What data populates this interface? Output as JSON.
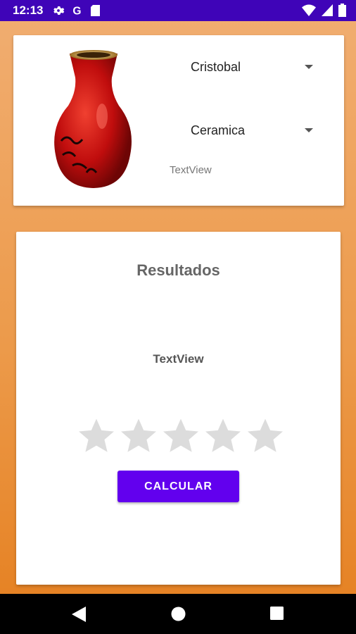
{
  "status_bar": {
    "time": "12:13",
    "left_icons": [
      "gear-icon",
      "google-icon",
      "sd-card-icon"
    ],
    "right_icons": [
      "wifi-icon",
      "signal-icon",
      "battery-icon"
    ]
  },
  "top_card": {
    "image": "red-vase",
    "spinner_author": "Cristobal",
    "spinner_material": "Ceramica",
    "textview": "TextView"
  },
  "results_card": {
    "title": "Resultados",
    "textview": "TextView",
    "rating": {
      "value": 0,
      "max": 5
    },
    "button_label": "CALCULAR"
  },
  "colors": {
    "status_bar": "#3f04b8",
    "accent_button": "#6200ee",
    "star_empty": "#dcdcdc",
    "bg_top": "#f1ae72",
    "bg_bottom": "#e57f1f"
  },
  "nav_bar": [
    "back-icon",
    "home-icon",
    "recents-icon"
  ]
}
